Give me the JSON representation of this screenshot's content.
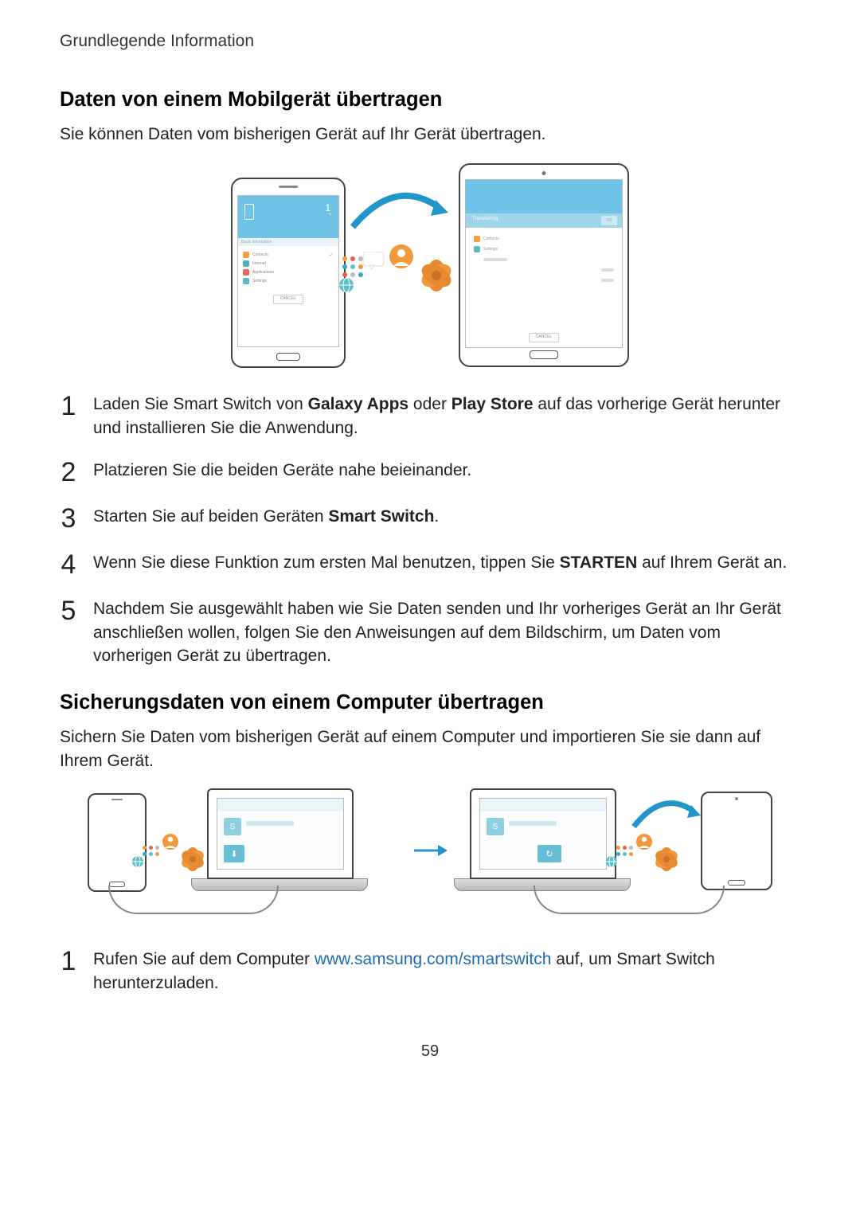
{
  "header": {
    "section_title": "Grundlegende Information"
  },
  "section1": {
    "title": "Daten von einem Mobilgerät übertragen",
    "intro": "Sie können Daten vom bisherigen Gerät auf Ihr Gerät übertragen.",
    "phones": {
      "phone_percent": "1",
      "phone_items": {
        "contacts": "Contacts",
        "internet": "Internet",
        "apps": "Applications",
        "settings": "Settings"
      },
      "cancel": "CANCEL",
      "tablet_header": "Transferring",
      "tablet_percent": "1%",
      "tablet_items": {
        "contacts": "Contacts",
        "settings": "Settings"
      },
      "tablet_cancel": "CANCEL"
    },
    "steps": {
      "n1": "1",
      "t1_a": "Laden Sie Smart Switch von ",
      "t1_bold1": "Galaxy Apps",
      "t1_b": " oder ",
      "t1_bold2": "Play Store",
      "t1_c": " auf das vorherige Gerät herunter und installieren Sie die Anwendung.",
      "n2": "2",
      "t2": "Platzieren Sie die beiden Geräte nahe beieinander.",
      "n3": "3",
      "t3_a": "Starten Sie auf beiden Geräten ",
      "t3_bold": "Smart Switch",
      "t3_b": ".",
      "n4": "4",
      "t4_a": "Wenn Sie diese Funktion zum ersten Mal benutzen, tippen Sie ",
      "t4_bold": "STARTEN",
      "t4_b": " auf Ihrem Gerät an.",
      "n5": "5",
      "t5": "Nachdem Sie ausgewählt haben wie Sie Daten senden und Ihr vorheriges Gerät an Ihr Gerät anschließen wollen, folgen Sie den Anweisungen auf dem Bildschirm, um Daten vom vorherigen Gerät zu übertragen."
    }
  },
  "section2": {
    "title": "Sicherungsdaten von einem Computer übertragen",
    "intro": "Sichern Sie Daten vom bisherigen Gerät auf einem Computer und importieren Sie sie dann auf Ihrem Gerät.",
    "steps": {
      "n1": "1",
      "t1_a": "Rufen Sie auf dem Computer ",
      "t1_link": "www.samsung.com/smartswitch",
      "t1_b": " auf, um Smart Switch herunterzuladen."
    }
  },
  "page_number": "59"
}
